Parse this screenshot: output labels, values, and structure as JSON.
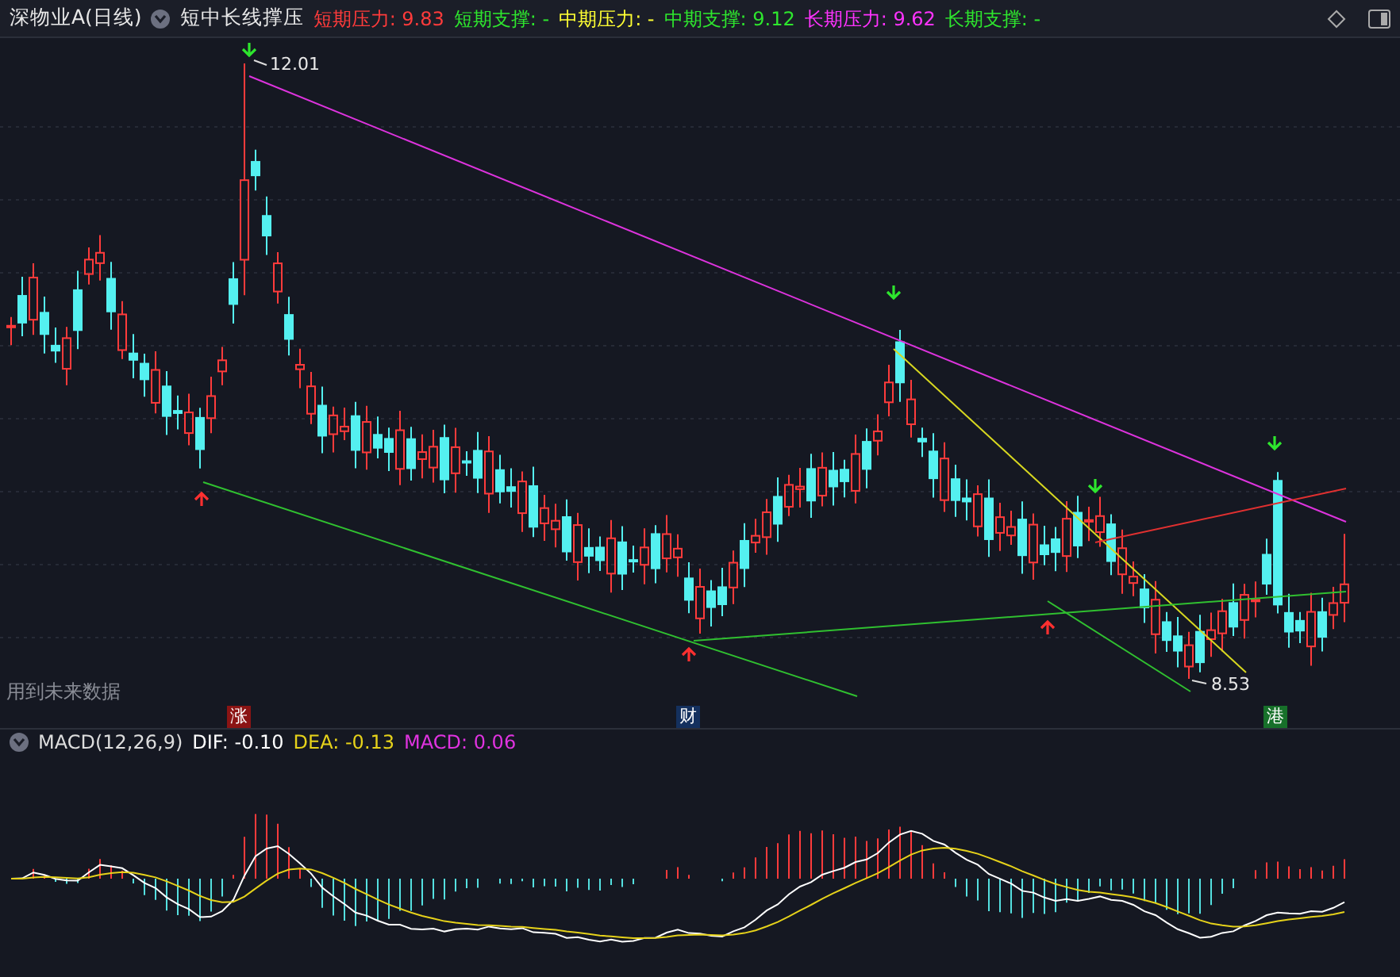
{
  "title": "深物业A(日线)",
  "indicator": {
    "name": "短中长线撑压",
    "values": [
      {
        "label": "短期压力: 9.83",
        "color": "#ff3b3b"
      },
      {
        "label": "短期支撑: -",
        "color": "#2ee62e"
      },
      {
        "label": "中期压力: -",
        "color": "#ffff33"
      },
      {
        "label": "中期支撑: 9.12",
        "color": "#2ee62e"
      },
      {
        "label": "长期压力: 9.62",
        "color": "#ff33ff"
      },
      {
        "label": "长期支撑: -",
        "color": "#2ee62e"
      }
    ]
  },
  "chart": {
    "high_label": "12.01",
    "low_label": "8.53",
    "note": "用到未来数据"
  },
  "markers": [
    {
      "text": "涨",
      "color": "#8b1414"
    },
    {
      "text": "财",
      "color": "#14305e"
    },
    {
      "text": "港",
      "color": "#17702a"
    }
  ],
  "macd": {
    "title": "MACD(12,26,9)",
    "values": [
      {
        "label": "DIF: -0.10",
        "color": "#ffffff"
      },
      {
        "label": "DEA: -0.13",
        "color": "#e6d21a"
      },
      {
        "label": "MACD: 0.06",
        "color": "#e033e0"
      }
    ]
  }
}
